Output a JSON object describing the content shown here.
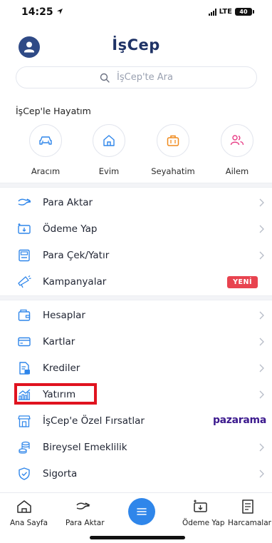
{
  "status_bar": {
    "time": "14:25",
    "network": "LTE",
    "battery": "40"
  },
  "header": {
    "title": "İşCep"
  },
  "search": {
    "placeholder": "İşCep'te Ara"
  },
  "life_section": {
    "title": "İşCep'le Hayatım",
    "items": [
      {
        "label": "Aracım",
        "icon": "car-icon"
      },
      {
        "label": "Evim",
        "icon": "house-icon"
      },
      {
        "label": "Seyahatim",
        "icon": "suitcase-icon"
      },
      {
        "label": "Ailem",
        "icon": "family-icon"
      }
    ]
  },
  "menu_group_1": [
    {
      "label": "Para Aktar",
      "icon": "money-transfer-icon"
    },
    {
      "label": "Ödeme Yap",
      "icon": "payment-icon"
    },
    {
      "label": "Para Çek/Yatır",
      "icon": "atm-icon"
    },
    {
      "label": "Kampanyalar",
      "icon": "megaphone-icon",
      "badge": "YENİ"
    }
  ],
  "menu_group_2": [
    {
      "label": "Hesaplar",
      "icon": "wallet-icon"
    },
    {
      "label": "Kartlar",
      "icon": "card-icon"
    },
    {
      "label": "Krediler",
      "icon": "loan-document-icon"
    },
    {
      "label": "Yatırım",
      "icon": "investment-chart-icon",
      "highlighted": true
    },
    {
      "label": "İşCep'e Özel Fırsatlar",
      "icon": "store-icon",
      "partner": "pazarama"
    },
    {
      "label": "Bireysel Emeklilik",
      "icon": "coins-icon"
    },
    {
      "label": "Sigorta",
      "icon": "shield-icon"
    }
  ],
  "tab_bar": [
    {
      "label": "Ana Sayfa",
      "icon": "home-icon"
    },
    {
      "label": "Para Aktar",
      "icon": "money-transfer-icon"
    },
    {
      "label": "",
      "icon": "menu-icon"
    },
    {
      "label": "Ödeme Yap",
      "icon": "payment-icon"
    },
    {
      "label": "Harcamalar",
      "icon": "expenses-icon"
    }
  ],
  "colors": {
    "brand_navy": "#1f3366",
    "accent_blue": "#2f86ea",
    "badge_red": "#e8434f",
    "highlight_red": "#e0131f",
    "partner_purple": "#3c1a8e"
  }
}
